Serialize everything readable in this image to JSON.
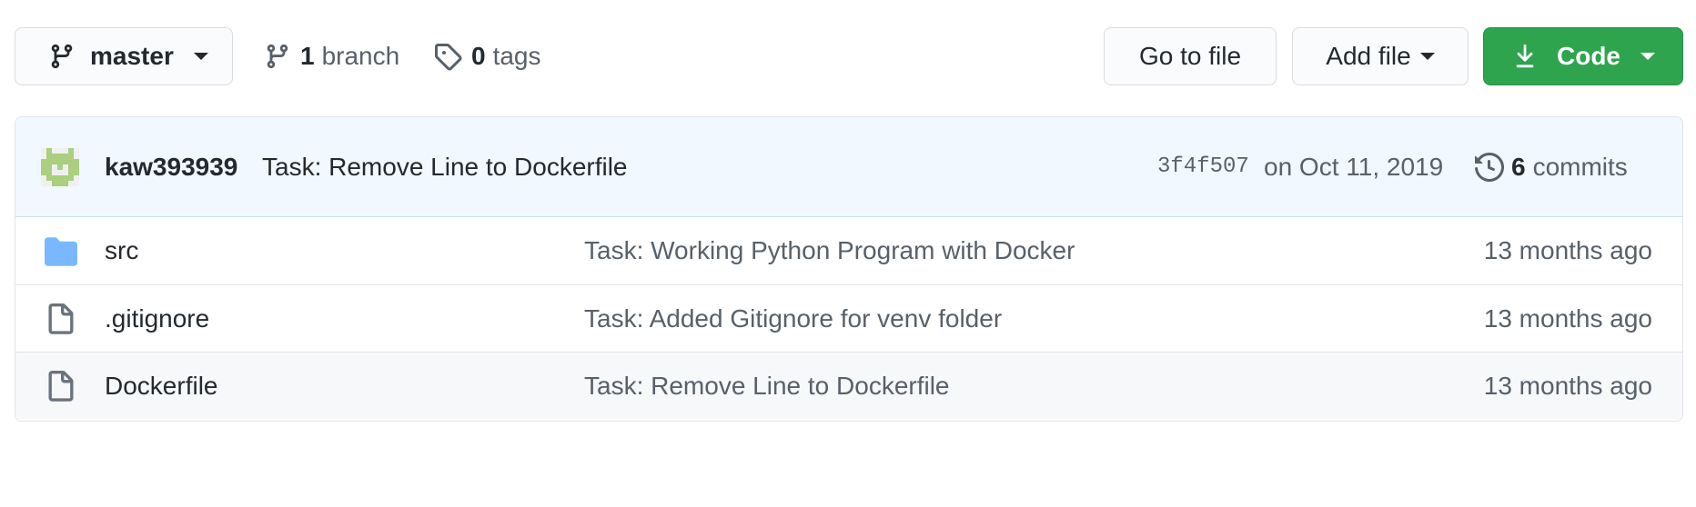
{
  "branch_selector": {
    "label": "master"
  },
  "stats": {
    "branch_count": "1",
    "branch_label": "branch",
    "tag_count": "0",
    "tag_label": "tags"
  },
  "actions": {
    "go_to_file": "Go to file",
    "add_file": "Add file",
    "code": "Code"
  },
  "latest_commit": {
    "author": "kaw393939",
    "message": "Task: Remove Line to Dockerfile",
    "sha": "3f4f507",
    "date": "on Oct 11, 2019",
    "commit_count": "6",
    "commit_label": "commits"
  },
  "files": [
    {
      "type": "folder",
      "name": "src",
      "message": "Task: Working Python Program with Docker",
      "age": "13 months ago"
    },
    {
      "type": "file",
      "name": ".gitignore",
      "message": "Task: Added Gitignore for venv folder",
      "age": "13 months ago"
    },
    {
      "type": "file",
      "name": "Dockerfile",
      "message": "Task: Remove Line to Dockerfile",
      "age": "13 months ago"
    }
  ],
  "colors": {
    "code_button": "#2ea44f",
    "commit_bar": "#f1f8ff",
    "folder_icon": "#79b8ff"
  }
}
